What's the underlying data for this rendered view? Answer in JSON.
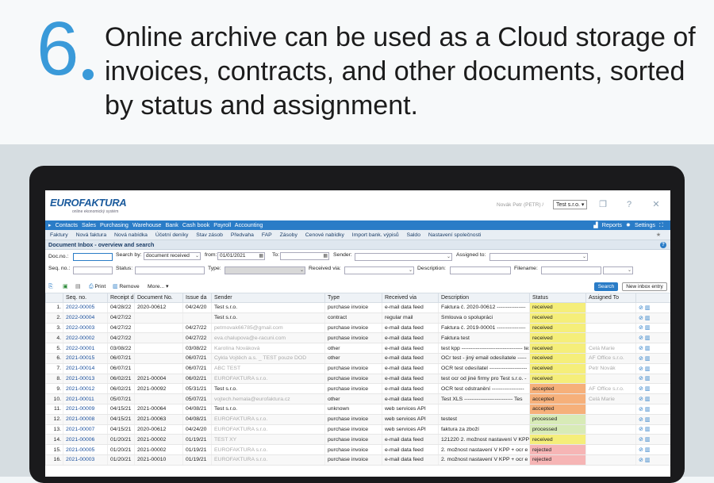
{
  "hero": {
    "number": "6",
    "text": "Online archive can be used as a Cloud storage of invoices, contracts, and other documents, sorted by status and assignment."
  },
  "app": {
    "logo": "EUROFAKTURA",
    "tagline": "online ekonomický systém",
    "user": "Novák Petr (PETR) /",
    "company": "Test s.r.o.",
    "menu": [
      "Contacts",
      "Sales",
      "Purchasing",
      "Warehouse",
      "Bank",
      "Cash book",
      "Payroll",
      "Accounting"
    ],
    "menu_right": {
      "reports": "Reports",
      "settings": "Settings"
    },
    "submenu": [
      "Faktury",
      "Nová faktura",
      "Nová nabídka",
      "Účetní deníky",
      "Stav zásob",
      "Předvaha",
      "FAP",
      "Zásoby",
      "Cenové nabídky",
      "Import bank. výpisů",
      "Saldo",
      "Nastavení společnosti"
    ],
    "page_title": "Document Inbox - overview and search"
  },
  "filters": {
    "doc_no": "Doc.no.:",
    "search_by": "Search by:",
    "search_by_value": "document received",
    "from": "from:",
    "from_value": "01/01/2021",
    "to": "To:",
    "sender": "Sender:",
    "assigned_to": "Assigned to:",
    "seq_no": "Seq. no.:",
    "status": "Status:",
    "type": "Type:",
    "received_via": "Received via:",
    "description": "Description:",
    "filename": "Filename:"
  },
  "toolbar": {
    "print": "Print",
    "remove": "Remove",
    "more": "More...",
    "search": "Search",
    "new_inbox": "New inbox entry"
  },
  "columns": [
    "",
    "Seq. no.",
    "Receipt d",
    "Document No.",
    "Issue da",
    "Sender",
    "Type",
    "Received via",
    "Description",
    "Status",
    "Assigned To",
    ""
  ],
  "rows": [
    [
      "1.",
      "2022-00005",
      "04/28/22",
      "2020-00612",
      "04/24/20",
      "Test s.r.o.",
      "purchase invoice",
      "e-mail data feed",
      "Faktura č. 2020-00612 ----------------",
      "received",
      ""
    ],
    [
      "2.",
      "2022-00004",
      "04/27/22",
      "",
      "",
      "Test s.r.o.",
      "contract",
      "regular mail",
      "Smlouva o spolupráci",
      "received",
      ""
    ],
    [
      "3.",
      "2022-00003",
      "04/27/22",
      "",
      "04/27/22",
      "petrnovak66785@gmail.com",
      "purchase invoice",
      "e-mail data feed",
      "Faktura č. 2019-00001 ----------------",
      "received",
      ""
    ],
    [
      "4.",
      "2022-00002",
      "04/27/22",
      "",
      "04/27/22",
      "eva.chalupova@e-racuni.com",
      "purchase invoice",
      "e-mail data feed",
      "Faktura test",
      "received",
      ""
    ],
    [
      "5.",
      "2022-00001",
      "03/08/22",
      "",
      "03/08/22",
      "Karolína Nováková",
      "other",
      "e-mail data feed",
      "test kpp ---------------------------------- text",
      "received",
      "Celá Marie"
    ],
    [
      "6.",
      "2021-00015",
      "06/07/21",
      "",
      "06/07/21",
      "Cykla Vojtěch a.s. _ TEST pouze DOD",
      "other",
      "e-mail data feed",
      "OCr test - jiný email odesílatele -----",
      "received",
      "AF Office s.r.o."
    ],
    [
      "7.",
      "2021-00014",
      "06/07/21",
      "",
      "06/07/21",
      "ABC TEST",
      "purchase invoice",
      "e-mail data feed",
      "OCR test odesílatel ---------------------",
      "received",
      "Petr Novák"
    ],
    [
      "8.",
      "2021-00013",
      "06/02/21",
      "2021-00004",
      "06/02/21",
      "EUROFAKTURA s.r.o.",
      "purchase invoice",
      "e-mail data feed",
      "test ocr od jiné firmy pro Test s.r.o. -",
      "received",
      ""
    ],
    [
      "9.",
      "2021-00012",
      "06/02/21",
      "2021-00092",
      "05/31/21",
      "Test s.r.o.",
      "purchase invoice",
      "e-mail data feed",
      "OCR test odstranění ------------------",
      "accepted",
      "AF Office s.r.o."
    ],
    [
      "10.",
      "2021-00011",
      "05/07/21",
      "",
      "05/07/21",
      "vojtech.hemala@eurofaktura.cz",
      "other",
      "e-mail data feed",
      "Test XLS --------------------------- Tes",
      "accepted",
      "Celá Marie"
    ],
    [
      "11.",
      "2021-00009",
      "04/15/21",
      "2021-00064",
      "04/08/21",
      "Test s.r.o.",
      "unknown",
      "web services API",
      "",
      "accepted",
      ""
    ],
    [
      "12.",
      "2021-00008",
      "04/15/21",
      "2021-00063",
      "04/08/21",
      "EUROFAKTURA s.r.o.",
      "purchase invoice",
      "web services API",
      "testest",
      "processed",
      ""
    ],
    [
      "13.",
      "2021-00007",
      "04/15/21",
      "2020-00612",
      "04/24/20",
      "EUROFAKTURA s.r.o.",
      "purchase invoice",
      "web services API",
      "faktura za zboží",
      "processed",
      ""
    ],
    [
      "14.",
      "2021-00006",
      "01/20/21",
      "2021-00002",
      "01/19/21",
      "TEST XY",
      "purchase invoice",
      "e-mail data feed",
      "121220 2. možnost nastavení V KPP",
      "received",
      ""
    ],
    [
      "15.",
      "2021-00005",
      "01/20/21",
      "2021-00002",
      "01/19/21",
      "EUROFAKTURA s.r.o.",
      "purchase invoice",
      "e-mail data feed",
      "2. možnost nastavení V KPP + ocr e",
      "rejected",
      ""
    ],
    [
      "16.",
      "2021-00003",
      "01/20/21",
      "2021-00010",
      "01/19/21",
      "EUROFAKTURA s.r.o.",
      "purchase invoice",
      "e-mail data feed",
      "2. možnost nastavení V KPP + ocr e",
      "rejected",
      ""
    ]
  ],
  "colors": {
    "received": "#f5ee7a",
    "accepted": "#f6b07a",
    "processed": "#d8ebb7",
    "rejected": "#f6b5b5",
    "menu": "#2a7cc7",
    "accent": "#3a9ad9"
  }
}
